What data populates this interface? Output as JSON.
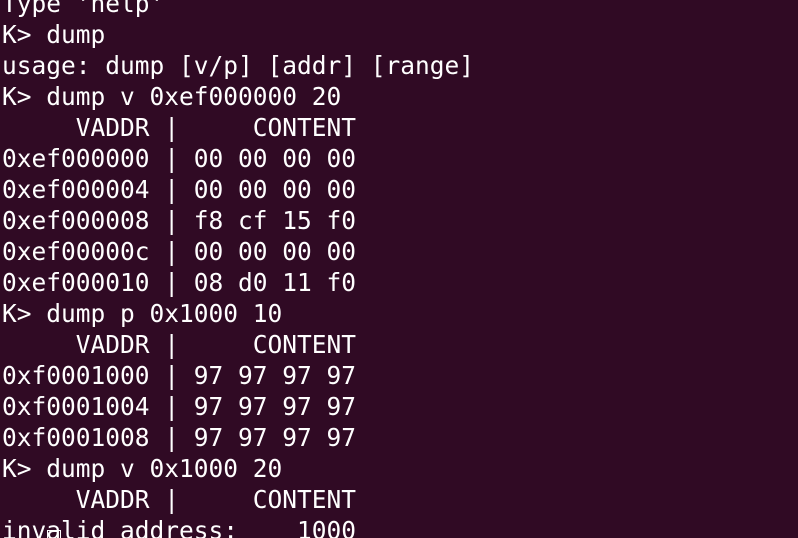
{
  "terminal": {
    "colors": {
      "background": "#300a24",
      "foreground": "#ffffff"
    },
    "lines": [
      "Type 'help'",
      "K> dump",
      "usage: dump [v/p] [addr] [range]",
      "K> dump v 0xef000000 20",
      "     VADDR |     CONTENT",
      "0xef000000 | 00 00 00 00",
      "0xef000004 | 00 00 00 00",
      "0xef000008 | f8 cf 15 f0",
      "0xef00000c | 00 00 00 00",
      "0xef000010 | 08 d0 11 f0",
      "K> dump p 0x1000 10",
      "     VADDR |     CONTENT",
      "0xf0001000 | 97 97 97 97",
      "0xf0001004 | 97 97 97 97",
      "0xf0001008 | 97 97 97 97",
      "K> dump v 0x1000 20",
      "     VADDR |     CONTENT",
      "invalid address:    1000"
    ]
  }
}
